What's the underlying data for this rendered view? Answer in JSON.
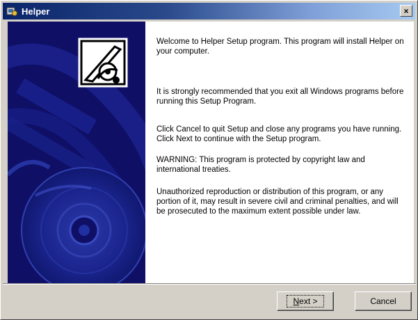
{
  "window": {
    "title": "Helper",
    "close_glyph": "×",
    "title_icon": "setup-icon"
  },
  "panel": {
    "logo": "setup-wizard-logo",
    "art": "disc-artwork",
    "background_color": "#0f0f66"
  },
  "content": {
    "paragraphs": [
      "Welcome to Helper Setup program. This program will install Helper on your computer.",
      "It is strongly recommended that you exit all Windows programs before running this Setup Program.",
      "Click Cancel to quit Setup and close any programs you have running. Click Next to continue with the Setup program.",
      "WARNING: This program is protected by copyright law and international treaties.",
      "Unauthorized reproduction or distribution of this program, or any portion of it, may result in severe civil and criminal penalties, and will be prosecuted to the maximum extent possible under law."
    ]
  },
  "buttons": {
    "next_mnemonic": "N",
    "next_rest": "ext >",
    "cancel": "Cancel"
  },
  "colors": {
    "titlebar_start": "#0a246a",
    "titlebar_end": "#a6caf0",
    "face": "#d4d0c8"
  }
}
